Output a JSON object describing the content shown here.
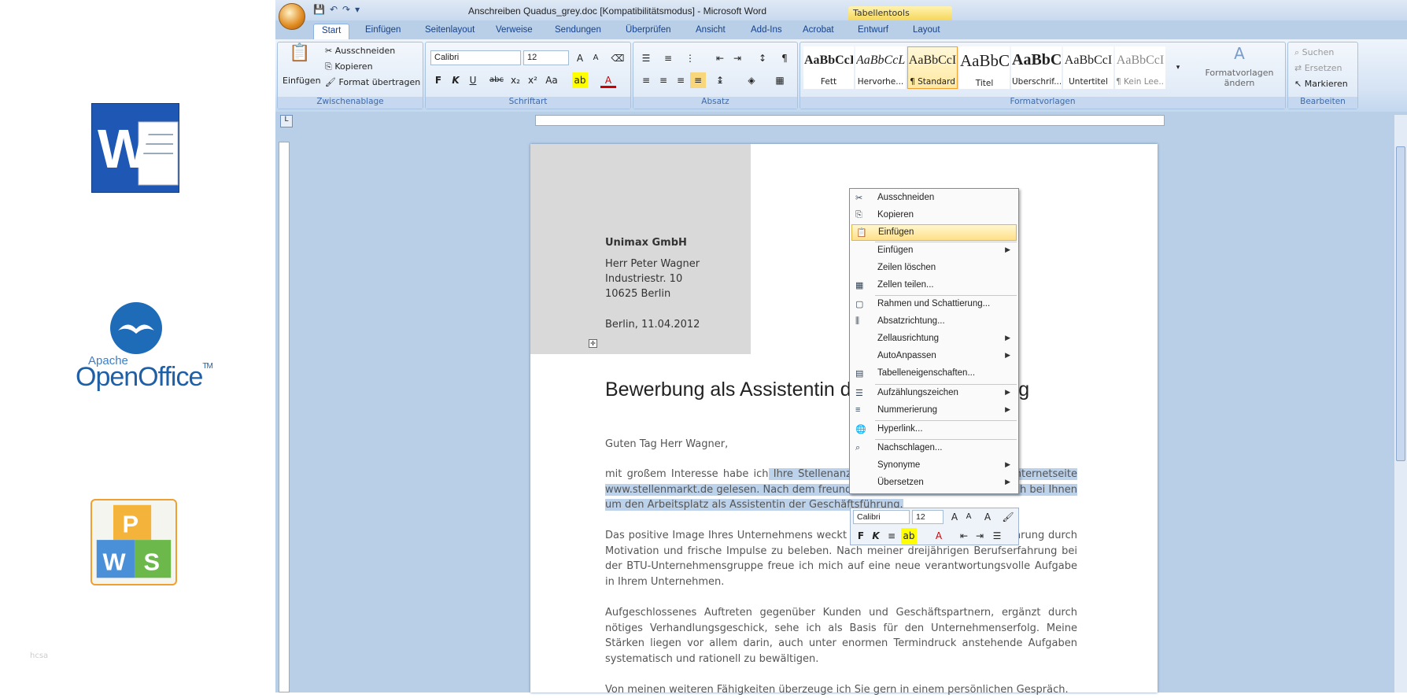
{
  "window": {
    "title": "Anschreiben Quadus_grey.doc [Kompatibilitätsmodus] - Microsoft Word",
    "context_tab_group": "Tabellentools"
  },
  "tabs": [
    "Start",
    "Einfügen",
    "Seitenlayout",
    "Verweise",
    "Sendungen",
    "Überprüfen",
    "Ansicht",
    "Add-Ins",
    "Acrobat",
    "Entwurf",
    "Layout"
  ],
  "ribbon": {
    "clipboard": {
      "paste": "Einfügen",
      "cut": "Ausschneiden",
      "copy": "Kopieren",
      "format_painter": "Format übertragen",
      "label": "Zwischenablage"
    },
    "font": {
      "name": "Calibri",
      "size": "12",
      "label": "Schriftart"
    },
    "paragraph": {
      "label": "Absatz"
    },
    "styles": {
      "items": [
        {
          "preview": "AaBbCcI",
          "name": "Fett"
        },
        {
          "preview": "AaBbCcL",
          "name": "Hervorhe..."
        },
        {
          "preview": "AaBbCcI",
          "name": "¶ Standard"
        },
        {
          "preview": "AaBbC",
          "name": "Titel"
        },
        {
          "preview": "AaBbC",
          "name": "Überschrif..."
        },
        {
          "preview": "AaBbCcI",
          "name": "Untertitel"
        },
        {
          "preview": "AaBbCcI",
          "name": "¶ Kein Lee..."
        }
      ],
      "change_label": "Formatvorlagen ändern",
      "label": "Formatvorlagen"
    },
    "editing": {
      "find": "Suchen",
      "replace": "Ersetzen",
      "select": "Markieren",
      "label": "Bearbeiten"
    }
  },
  "document": {
    "company": "Unimax GmbH",
    "contact": "Herr Peter Wagner",
    "street": "Industriestr. 10",
    "city": "10625 Berlin",
    "date": "Berlin, 11.04.2012",
    "title": "Bewerbung als Assistentin der Geschäftsführung",
    "greeting": "Guten Tag Herr Wagner,",
    "p1_a": "mit großem Interesse habe ich",
    "p1_b": " Ihre Stellenanzeige vom 02.04.2012 auf der Internetseite www.stellenmarkt.de gelesen. Nach dem freundlichen Telefonat bewerbe ich mich bei Ihnen um den Arbeitsplatz als Assistentin der Geschäftsführung.",
    "p2": "Das positive Image Ihres Unternehmens weckt mein Interesse, die Geschäftsführung durch Motivation und frische Impulse zu beleben. Nach meiner dreijährigen Berufserfahrung bei der BTU-Unternehmensgruppe freue ich mich auf eine neue verantwortungsvolle Aufgabe in Ihrem Unternehmen.",
    "p3": "Aufgeschlossenes Auftreten gegenüber Kunden und Geschäftspartnern, ergänzt durch nötiges Verhandlungsgeschick, sehe ich als Basis für den Unternehmenserfolg. Meine Stärken liegen vor allem darin, auch unter enormen Termindruck anstehende Aufgaben systematisch und rationell zu bewältigen.",
    "p4": "Von meinen weiteren Fähigkeiten überzeuge ich Sie gern in einem persönlichen Gespräch."
  },
  "context_menu": [
    {
      "label": "Ausschneiden",
      "icon": "scissors-icon",
      "submenu": false
    },
    {
      "label": "Kopieren",
      "icon": "copy-icon",
      "submenu": false
    },
    {
      "label": "Einfügen",
      "icon": "paste-icon",
      "submenu": false,
      "highlighted": true
    },
    {
      "label": "Einfügen",
      "icon": "",
      "submenu": true
    },
    {
      "label": "Zeilen löschen",
      "icon": "",
      "submenu": false
    },
    {
      "label": "Zellen teilen...",
      "icon": "table-icon",
      "submenu": false
    },
    {
      "label": "Rahmen und Schattierung...",
      "icon": "border-icon",
      "submenu": false
    },
    {
      "label": "Absatzrichtung...",
      "icon": "text-direction-icon",
      "submenu": false
    },
    {
      "label": "Zellausrichtung",
      "icon": "",
      "submenu": true
    },
    {
      "label": "AutoAnpassen",
      "icon": "",
      "submenu": true
    },
    {
      "label": "Tabelleneigenschaften...",
      "icon": "table-properties-icon",
      "submenu": false
    },
    {
      "label": "Aufzählungszeichen",
      "icon": "bullets-icon",
      "submenu": true
    },
    {
      "label": "Nummerierung",
      "icon": "numbering-icon",
      "submenu": true
    },
    {
      "label": "Hyperlink...",
      "icon": "hyperlink-icon",
      "submenu": false
    },
    {
      "label": "Nachschlagen...",
      "icon": "research-icon",
      "submenu": false
    },
    {
      "label": "Synonyme",
      "icon": "",
      "submenu": true
    },
    {
      "label": "Übersetzen",
      "icon": "",
      "submenu": true
    }
  ],
  "mini_toolbar": {
    "font": "Calibri",
    "size": "12"
  },
  "sidebar_logos": {
    "openoffice_apache": "Apache",
    "openoffice_name": "OpenOffice",
    "openoffice_tm": "TM"
  },
  "watermark": "hcsa",
  "colors": {
    "ribbon_blue": "#b9cfe7",
    "accent": "#f0a030",
    "selection": "#bcd1ea"
  }
}
